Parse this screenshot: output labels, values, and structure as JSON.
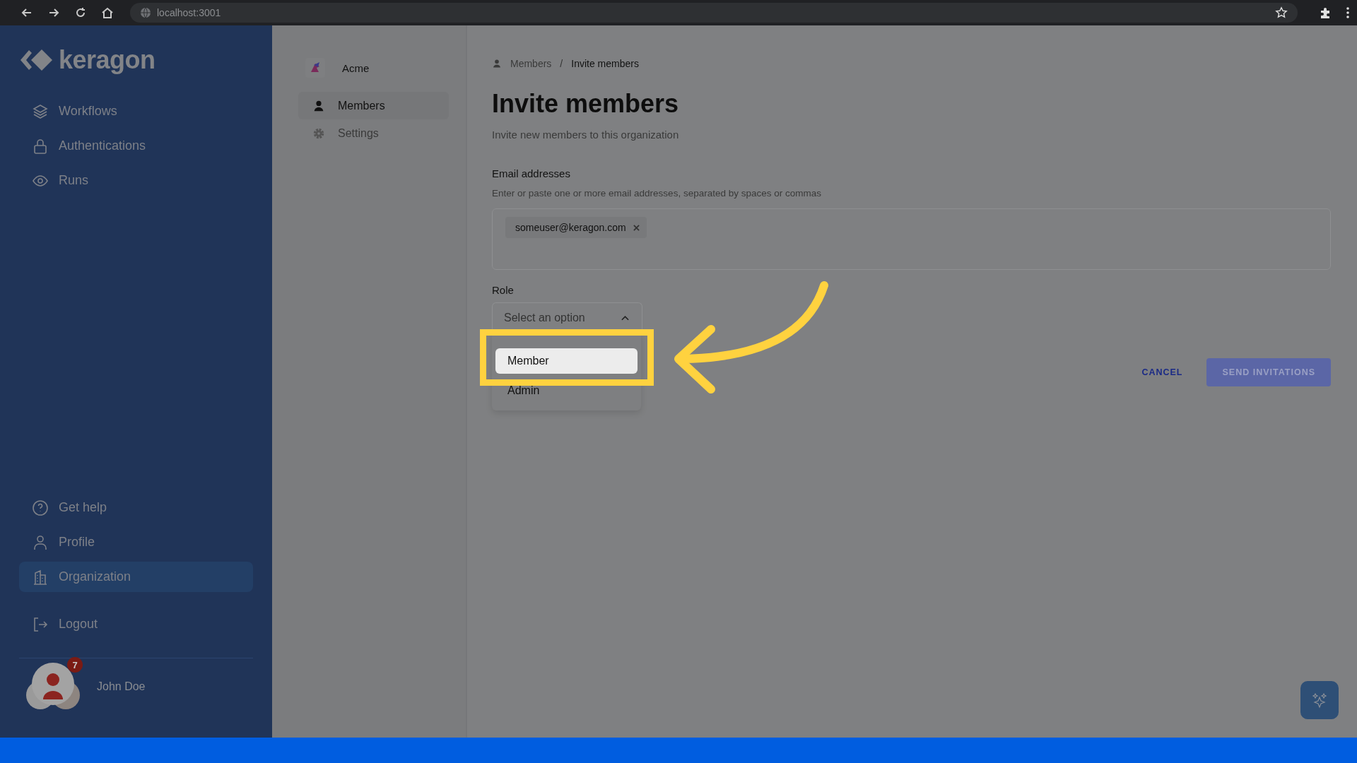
{
  "browser": {
    "url": "localhost:3001"
  },
  "sidebar": {
    "logo": "keragon",
    "top_items": [
      {
        "label": "Workflows",
        "selected": false
      },
      {
        "label": "Authentications",
        "selected": false
      },
      {
        "label": "Runs",
        "selected": false
      }
    ],
    "bottom_items": [
      {
        "label": "Get help",
        "selected": false
      },
      {
        "label": "Profile",
        "selected": false
      },
      {
        "label": "Organization",
        "selected": true
      }
    ],
    "logout": "Logout",
    "user": {
      "name": "John Doe",
      "badge": "7"
    }
  },
  "org_nav": {
    "name": "Acme",
    "items": [
      {
        "label": "Members",
        "selected": true
      },
      {
        "label": "Settings",
        "selected": false
      }
    ]
  },
  "breadcrumb": [
    "Members",
    "Invite members"
  ],
  "breadcrumb_separator": "/",
  "title": "Invite members",
  "subtitle": "Invite new members to this organization",
  "email": {
    "label": "Email addresses",
    "help": "Enter or paste one or more email addresses, separated by spaces or commas",
    "chips": [
      "someuser@keragon.com"
    ]
  },
  "role": {
    "label": "Role",
    "placeholder": "Select an option",
    "expanded": true,
    "options": [
      {
        "label": "Member",
        "selected": true
      },
      {
        "label": "Admin",
        "selected": false
      }
    ]
  },
  "buttons": {
    "cancel": "CANCEL",
    "send": "SEND INVITATIONS"
  }
}
